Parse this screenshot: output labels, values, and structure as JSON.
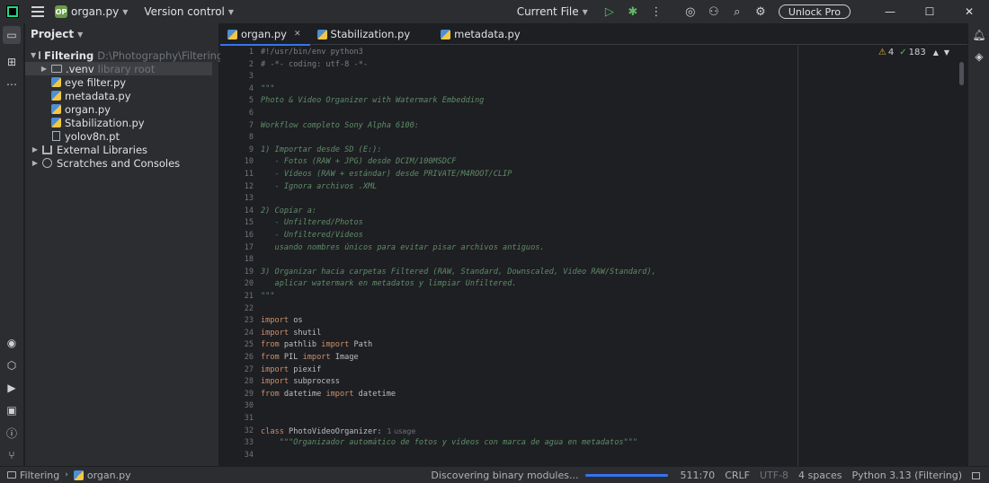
{
  "titlebar": {
    "project_badge": "OP",
    "project_name": "organ.py",
    "version_control": "Version control",
    "run_config": "Current File",
    "unlock_label": "Unlock Pro"
  },
  "project_panel": {
    "title": "Project",
    "root_name": "Filtering",
    "root_path": "D:\\Photography\\Filtering",
    "venv_name": ".venv",
    "venv_hint": "library root",
    "files": [
      "eye filter.py",
      "metadata.py",
      "organ.py",
      "Stabilization.py",
      "yolov8n.pt"
    ],
    "external_libraries": "External Libraries",
    "scratches": "Scratches and Consoles"
  },
  "tabs": [
    {
      "label": "organ.py",
      "active": true
    },
    {
      "label": "Stabilization.py",
      "active": false
    },
    {
      "label": "metadata.py",
      "active": false
    }
  ],
  "editor": {
    "warnings_count": "4",
    "checks_count": "183",
    "line_numbers": [
      "1",
      "2",
      "3",
      "4",
      "5",
      "6",
      "7",
      "8",
      "9",
      "10",
      "11",
      "12",
      "13",
      "14",
      "15",
      "16",
      "17",
      "18",
      "19",
      "20",
      "21",
      "22",
      "23",
      "24",
      "25",
      "26",
      "27",
      "28",
      "29",
      "30",
      "31",
      "32",
      "33",
      "34"
    ],
    "lines": {
      "l1": "#!/usr/bin/env python3",
      "l2": "# -*- coding: utf-8 -*-",
      "l4": "\"\"\"",
      "l5": "Photo & Video Organizer with Watermark Embedding",
      "l7": "Workflow completo Sony Alpha 6100:",
      "l9": "1) Importar desde SD (E:):",
      "l10": "   - Fotos (RAW + JPG) desde DCIM/100MSDCF",
      "l11": "   - Vídeos (RAW + estándar) desde PRIVATE/M4ROOT/CLIP",
      "l12": "   - Ignora archivos .XML",
      "l14": "2) Copiar a:",
      "l15": "   - Unfiltered/Photos",
      "l16": "   - Unfiltered/Videos",
      "l17": "   usando nombres únicos para evitar pisar archivos antiguos.",
      "l19": "3) Organizar hacia carpetas Filtered (RAW, Standard, Downscaled, Video RAW/Standard),",
      "l20": "   aplicar watermark en metadatos y limpiar Unfiltered.",
      "l21": "\"\"\"",
      "l23_kw": "import",
      "l23": " os",
      "l24_kw": "import",
      "l24": " shutil",
      "l25_kw": "from",
      "l25_a": " pathlib ",
      "l25_kw2": "import",
      "l25_b": " Path",
      "l26_kw": "from",
      "l26_a": " PIL ",
      "l26_kw2": "import",
      "l26_b": " Image",
      "l27_kw": "import",
      "l27": " piexif",
      "l28_kw": "import",
      "l28": " subprocess",
      "l29_kw": "from",
      "l29_a": " datetime ",
      "l29_kw2": "import",
      "l29_b": " datetime",
      "l32_kw": "class",
      "l32": " PhotoVideoOrganizer:",
      "l32_hint": "1 usage",
      "l33": "    \"\"\"Organizador automático de fotos y vídeos con marca de agua en metadatos\"\"\""
    }
  },
  "statusbar": {
    "crumb_folder": "Filtering",
    "crumb_file": "organ.py",
    "task": "Discovering binary modules...",
    "task_progress": 1.0,
    "position": "511:70",
    "line_sep": "CRLF",
    "encoding": "UTF-8",
    "indent": "4 spaces",
    "interpreter": "Python 3.13 (Filtering)"
  },
  "colors": {
    "accent": "#3574f0",
    "keyword": "#cf8e6d",
    "docstring": "#5f8c6a",
    "warning": "#e5b44f"
  }
}
